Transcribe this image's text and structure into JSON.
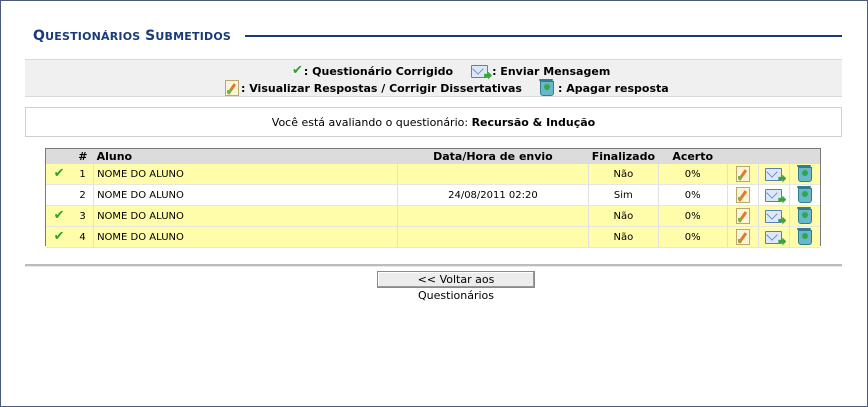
{
  "title": {
    "first_letter": "Q",
    "rest1": "UESTIONÁRIOS",
    "second_letter": "S",
    "rest2": "UBMETIDOS"
  },
  "legend": {
    "corrigido": "Questionário Corrigido",
    "enviar": "Enviar Mensagem",
    "visualizar": "Visualizar Respostas / Corrigir Dissertativas",
    "apagar": "Apagar resposta"
  },
  "info": {
    "prefix": "Você está avaliando o questionário:",
    "questionario": "Recursão & Indução"
  },
  "table": {
    "headers": {
      "num": "#",
      "aluno": "Aluno",
      "data": "Data/Hora de envio",
      "finalizado": "Finalizado",
      "acerto": "Acerto"
    },
    "rows": [
      {
        "corrigido": true,
        "num": "1",
        "aluno": "NOME DO ALUNO",
        "data": "",
        "finalizado": "Não",
        "acerto": "0%"
      },
      {
        "corrigido": false,
        "num": "2",
        "aluno": "NOME DO ALUNO",
        "data": "24/08/2011 02:20",
        "finalizado": "Sim",
        "acerto": "0%"
      },
      {
        "corrigido": true,
        "num": "3",
        "aluno": "NOME DO ALUNO",
        "data": "",
        "finalizado": "Não",
        "acerto": "0%"
      },
      {
        "corrigido": true,
        "num": "4",
        "aluno": "NOME DO ALUNO",
        "data": "",
        "finalizado": "Não",
        "acerto": "0%"
      }
    ]
  },
  "back_button": "<< Voltar aos Questionários",
  "colors": {
    "title": "#1a3a7a",
    "highlight_row": "#fffcaa",
    "header_bg": "#dcdcdc",
    "check": "#2fa02f"
  }
}
